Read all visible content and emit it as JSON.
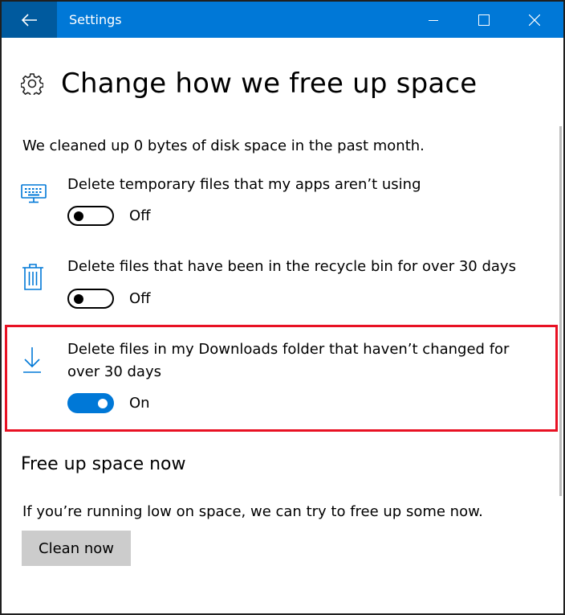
{
  "window": {
    "title": "Settings",
    "icons": {
      "back": "back-arrow-icon",
      "minimize": "minimize-icon",
      "maximize": "maximize-icon",
      "close": "close-icon"
    },
    "accent_color": "#0078d7"
  },
  "page": {
    "icon": "gear-icon",
    "title": "Change how we free up space",
    "intro": "We cleaned up 0 bytes of disk space in the past month."
  },
  "settings": [
    {
      "icon": "keyboard-icon",
      "label": "Delete temporary files that my apps aren’t using",
      "state": "Off",
      "enabled": false
    },
    {
      "icon": "trash-icon",
      "label": "Delete files that have been in the recycle bin for over 30 days",
      "state": "Off",
      "enabled": false
    },
    {
      "icon": "download-icon",
      "label_line1": "Delete files in my Downloads folder that haven’t changed for",
      "label_line2": "over 30 days",
      "state": "On",
      "enabled": true,
      "highlighted": true,
      "highlight_color": "#e81123"
    }
  ],
  "free_up": {
    "title": "Free up space now",
    "description": "If you’re running low on space, we can try to free up some now.",
    "button_label": "Clean now"
  }
}
